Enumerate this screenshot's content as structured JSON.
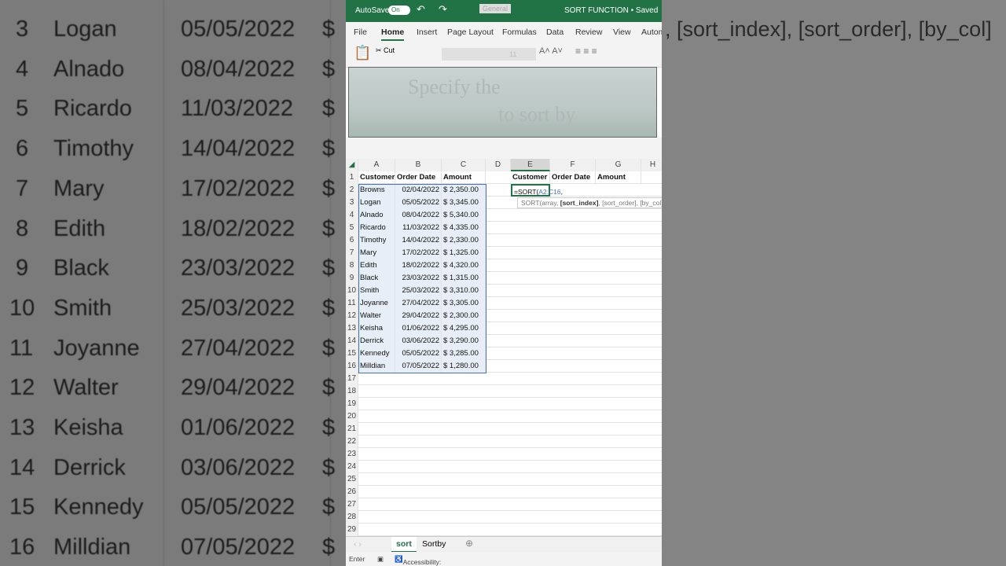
{
  "titlebar": {
    "autosave": "AutoSave",
    "toggle": "On",
    "number_format": "General",
    "doc_title": "SORT FUNCTION • Saved"
  },
  "menu": [
    "File",
    "Home",
    "Insert",
    "Page Layout",
    "Formulas",
    "Data",
    "Review",
    "View",
    "Autom"
  ],
  "ribbon": {
    "cut": "Cut",
    "font_size": "11"
  },
  "overlay": {
    "line1": "Specify the",
    "line2": "to sort by"
  },
  "columns": [
    "A",
    "B",
    "C",
    "D",
    "E",
    "F",
    "G",
    "H"
  ],
  "headers": {
    "customer": "Customer",
    "order_date": "Order Date",
    "amount": "Amount"
  },
  "rows": [
    [
      "Browns",
      "02/04/2022",
      "$ 2,350.00"
    ],
    [
      "Logan",
      "05/05/2022",
      "$ 3,345.00"
    ],
    [
      "Alnado",
      "08/04/2022",
      "$ 5,340.00"
    ],
    [
      "Ricardo",
      "11/03/2022",
      "$ 4,335.00"
    ],
    [
      "Timothy",
      "14/04/2022",
      "$ 2,330.00"
    ],
    [
      "Mary",
      "17/02/2022",
      "$ 1,325.00"
    ],
    [
      "Edith",
      "18/02/2022",
      "$ 4,320.00"
    ],
    [
      "Black",
      "23/03/2022",
      "$ 1,315.00"
    ],
    [
      "Smith",
      "25/03/2022",
      "$ 3,310.00"
    ],
    [
      "Joyanne",
      "27/04/2022",
      "$ 3,305.00"
    ],
    [
      "Walter",
      "29/04/2022",
      "$ 2,300.00"
    ],
    [
      "Keisha",
      "01/06/2022",
      "$ 4,295.00"
    ],
    [
      "Derrick",
      "03/06/2022",
      "$ 3,290.00"
    ],
    [
      "Kennedy",
      "05/05/2022",
      "$ 3,285.00"
    ],
    [
      "Milldian",
      "07/05/2022",
      "$ 1,280.00"
    ]
  ],
  "formula": {
    "prefix": "=SORT(",
    "ref": "A2:C16",
    "suffix": ","
  },
  "tooltip": {
    "fn": "SORT(array, ",
    "bold": "[sort_index]",
    "rest": ", [sort_order], [by_col]"
  },
  "sheets": [
    "sort",
    "Sortby"
  ],
  "status": {
    "mode": "Enter",
    "accessibility": "Accessibility: Good to go"
  },
  "background": {
    "right_hint": ", [sort_index], [sort_order], [by_col]"
  }
}
